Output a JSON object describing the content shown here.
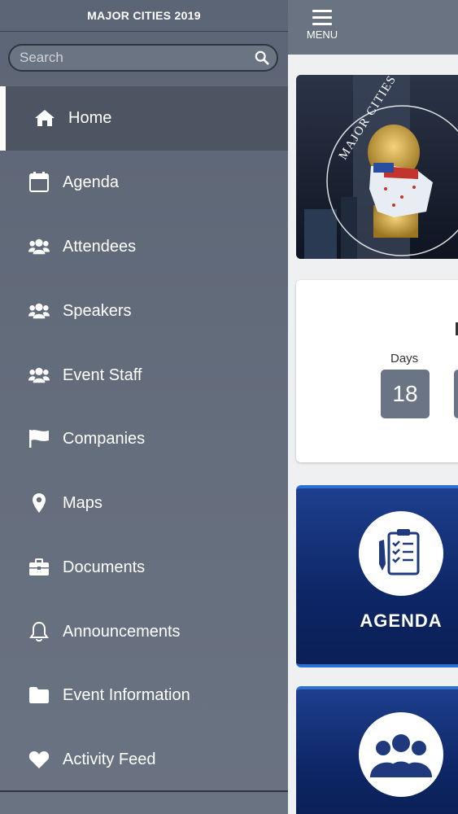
{
  "sidebar": {
    "title": "MAJOR CITIES 2019",
    "search": {
      "placeholder": "Search",
      "value": ""
    },
    "items": [
      {
        "label": "Home",
        "icon": "home-icon",
        "active": true
      },
      {
        "label": "Agenda",
        "icon": "calendar-icon"
      },
      {
        "label": "Attendees",
        "icon": "users-icon"
      },
      {
        "label": "Speakers",
        "icon": "users-icon"
      },
      {
        "label": "Event Staff",
        "icon": "users-icon"
      },
      {
        "label": "Companies",
        "icon": "flag-icon"
      },
      {
        "label": "Maps",
        "icon": "map-pin-icon"
      },
      {
        "label": "Documents",
        "icon": "briefcase-icon"
      },
      {
        "label": "Announcements",
        "icon": "bell-icon"
      },
      {
        "label": "Event Information",
        "icon": "folder-icon"
      },
      {
        "label": "Activity Feed",
        "icon": "heart-icon"
      }
    ]
  },
  "topbar": {
    "menu_label": "MENU"
  },
  "banner": {
    "text": "MAJOR CITIES CON"
  },
  "countdown": {
    "days_label": "Days",
    "days_value": "18"
  },
  "tiles": {
    "agenda": {
      "label": "AGENDA",
      "icon": "clipboard-checklist-icon"
    },
    "attendees": {
      "icon": "people-group-icon"
    }
  },
  "colors": {
    "sidebar": "#646d7c",
    "active_item": "#4d5563",
    "tile_blue": "#0d2666",
    "countdown_box": "#6b7484"
  }
}
